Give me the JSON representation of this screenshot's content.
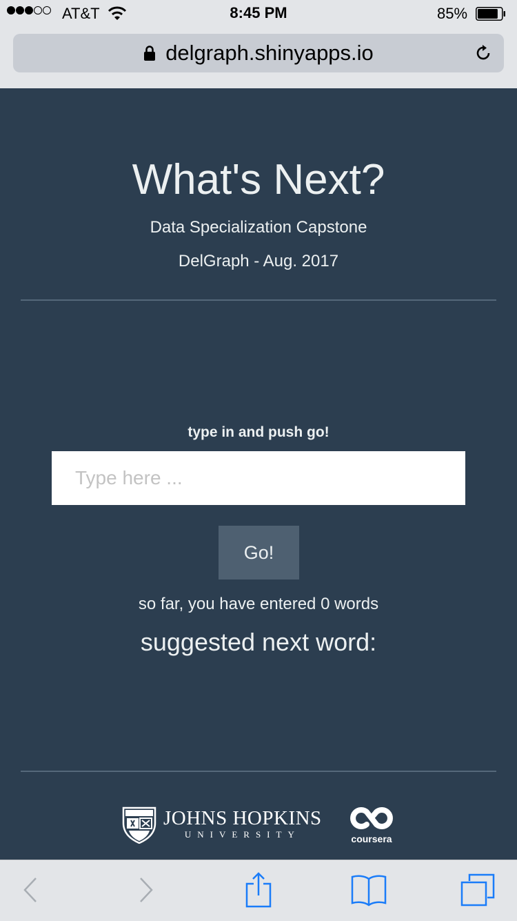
{
  "status_bar": {
    "carrier": "AT&T",
    "time": "8:45 PM",
    "battery_percent": "85%",
    "signal_bars": 3,
    "battery_level": 0.85
  },
  "browser": {
    "url": "delgraph.shinyapps.io",
    "secure_icon": "lock-icon",
    "reload_icon": "reload-icon"
  },
  "header": {
    "title": "What's Next?",
    "subtitle": "Data Specialization Capstone",
    "byline": "DelGraph - Aug. 2017"
  },
  "form": {
    "label": "type in and push go!",
    "input_placeholder": "Type here ...",
    "input_value": "",
    "go_button_label": "Go!"
  },
  "results": {
    "word_count_text": "so far, you have entered 0 words",
    "suggestion_heading": "suggested next word:"
  },
  "footer": {
    "jhu_name": "JOHNS HOPKINS",
    "jhu_sub": "UNIVERSITY",
    "coursera": "coursera"
  },
  "toolbar": {
    "icons": [
      "back-icon",
      "forward-icon",
      "share-icon",
      "bookmarks-icon",
      "tabs-icon"
    ]
  },
  "colors": {
    "background": "#2c3e50",
    "button": "#4e6071",
    "text": "#ecf0f1",
    "ios_blue": "#1a7cf9"
  }
}
